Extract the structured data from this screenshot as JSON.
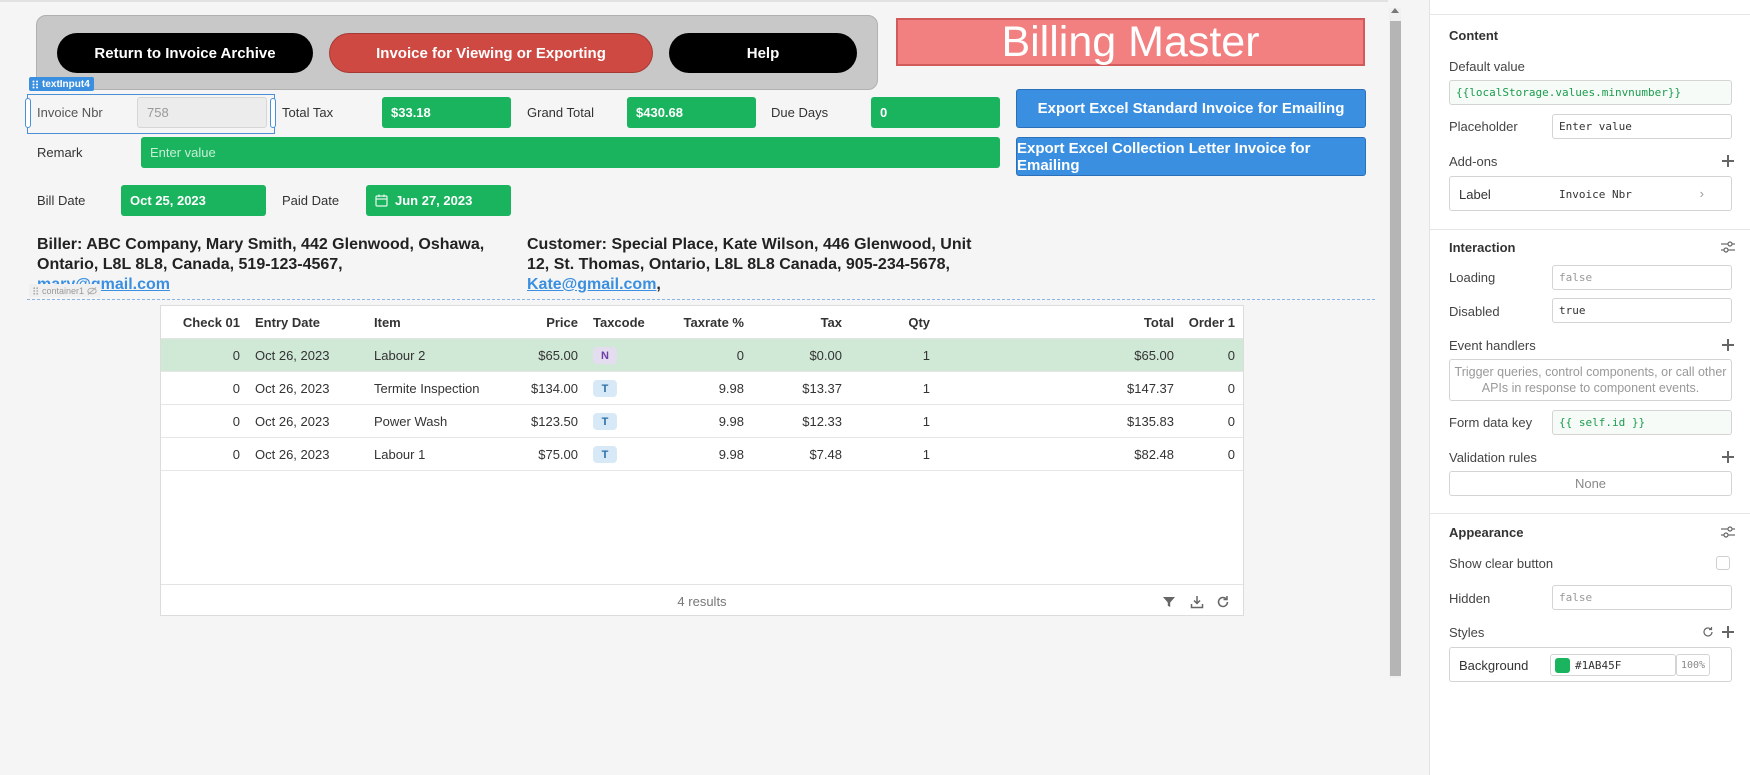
{
  "header": {
    "return_button": "Return to Invoice Archive",
    "invoice_button": "Invoice for Viewing or Exporting",
    "help_button": "Help",
    "app_title": "Billing Master"
  },
  "selection": {
    "component_tag": "textInput4",
    "container_tag": "container1"
  },
  "form": {
    "invoice_nbr_label": "Invoice Nbr",
    "invoice_nbr_value": "758",
    "total_tax_label": "Total Tax",
    "total_tax_value": "$33.18",
    "grand_total_label": "Grand Total",
    "grand_total_value": "$430.68",
    "due_days_label": "Due Days",
    "due_days_value": "0",
    "remark_label": "Remark",
    "remark_placeholder": "Enter value",
    "bill_date_label": "Bill Date",
    "bill_date_value": "Oct 25, 2023",
    "paid_date_label": "Paid Date",
    "paid_date_value": "Jun 27, 2023"
  },
  "export": {
    "standard_button": "Export Excel Standard Invoice for Emailing",
    "collection_button": "Export Excel Collection Letter Invoice for Emailing"
  },
  "biller": {
    "line1": "Biller: ABC Company, Mary Smith, 442 Glenwood, Oshawa,",
    "line2": "Ontario, L8L 8L8, Canada, 519-123-4567,",
    "email": "mary@gmail.com"
  },
  "customer": {
    "line1": "Customer: Special Place, Kate Wilson, 446 Glenwood, Unit",
    "line2": "12, St. Thomas, Ontario, L8L 8L8 Canada, 905-234-5678,",
    "email": "Kate@gmail.com",
    "trail": ","
  },
  "table": {
    "columns": [
      "Check 01",
      "Entry Date",
      "Item",
      "Price",
      "Taxcode",
      "Taxrate %",
      "Tax",
      "Qty",
      "Total",
      "Order 1"
    ],
    "rows": [
      [
        "0",
        "Oct 26, 2023",
        "Labour 2",
        "$65.00",
        "N",
        "0",
        "$0.00",
        "1",
        "$65.00",
        "0"
      ],
      [
        "0",
        "Oct 26, 2023",
        "Termite Inspection",
        "$134.00",
        "T",
        "9.98",
        "$13.37",
        "1",
        "$147.37",
        "0"
      ],
      [
        "0",
        "Oct 26, 2023",
        "Power Wash",
        "$123.50",
        "T",
        "9.98",
        "$12.33",
        "1",
        "$135.83",
        "0"
      ],
      [
        "0",
        "Oct 26, 2023",
        "Labour 1",
        "$75.00",
        "T",
        "9.98",
        "$7.48",
        "1",
        "$82.48",
        "0"
      ]
    ],
    "footer": "4 results"
  },
  "panel": {
    "content_title": "Content",
    "default_value_label": "Default value",
    "default_value": "{{localStorage.values.minvnumber}}",
    "placeholder_label": "Placeholder",
    "placeholder_value": "Enter value",
    "addons_label": "Add-ons",
    "label_key": "Label",
    "label_value": "Invoice Nbr",
    "interaction_title": "Interaction",
    "loading_label": "Loading",
    "loading_value": "false",
    "disabled_label": "Disabled",
    "disabled_value": "true",
    "event_handlers_label": "Event handlers",
    "event_handlers_hint": "Trigger queries, control components, or call other APIs in response to component events.",
    "form_data_key_label": "Form data key",
    "form_data_key_value": "{{ self.id }}",
    "validation_rules_label": "Validation rules",
    "validation_rules_value": "None",
    "appearance_title": "Appearance",
    "show_clear_label": "Show clear button",
    "hidden_label": "Hidden",
    "hidden_value": "false",
    "styles_label": "Styles",
    "background_label": "Background",
    "background_hex": "#1AB45F",
    "background_opacity": "100%"
  },
  "colors": {
    "accent_green": "#1ab45f",
    "accent_blue": "#3b8fe0",
    "accent_red": "#cf4943",
    "title_pink": "#f28080"
  }
}
